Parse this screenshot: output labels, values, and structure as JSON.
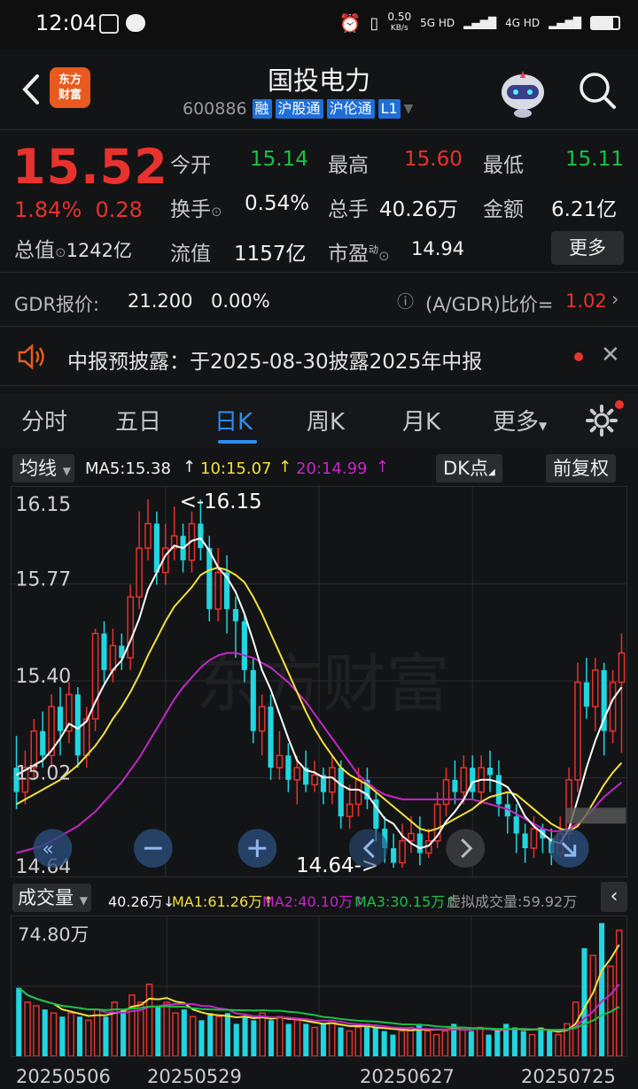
{
  "status": {
    "time": "12:04",
    "net_speed": "0.50",
    "net_unit": "KB/s",
    "sim1": "5G HD",
    "sim2": "4G HD"
  },
  "header": {
    "logo_line1": "东方",
    "logo_line2": "财富",
    "title": "国投电力",
    "code": "600886",
    "tags": [
      "融",
      "沪股通",
      "沪伦通",
      "L1"
    ]
  },
  "quote": {
    "price": "15.52",
    "pct": "1.84%",
    "change": "0.28",
    "mcap_label": "总值",
    "mcap": "1242亿",
    "open_label": "今开",
    "open": "15.14",
    "high_label": "最高",
    "high": "15.60",
    "low_label": "最低",
    "low": "15.11",
    "turnover_label": "换手",
    "turnover": "0.54%",
    "volume_label": "总手",
    "volume": "40.26万",
    "amount_label": "金额",
    "amount": "6.21亿",
    "float_label": "流值",
    "float_mcap": "1157亿",
    "pe_label": "市盈",
    "pe_sup": "动",
    "pe": "14.94",
    "more": "更多"
  },
  "gdr": {
    "label": "GDR报价:",
    "price": "21.200",
    "pct": "0.00%",
    "ratio_label": "(A/GDR)比价=",
    "ratio": "1.02"
  },
  "notice": {
    "text": "中报预披露：于2025-08-30披露2025年中报"
  },
  "tabs": [
    "分时",
    "五日",
    "日K",
    "周K",
    "月K",
    "更多"
  ],
  "ma_bar": {
    "selector": "均线",
    "ma5": "MA5:15.38",
    "ma10": "10:15.07",
    "ma20": "20:14.99",
    "dk": "DK点",
    "adjust": "前复权"
  },
  "kline_axis": [
    "16.15",
    "15.77",
    "15.40",
    "15.02",
    "14.64"
  ],
  "kline_annotations": {
    "high": "<-16.15",
    "low": "14.64->"
  },
  "vol_bar": {
    "selector": "成交量",
    "vol": "40.26万",
    "ma1": "MA1:61.26万",
    "ma2": "MA2:40.10万",
    "ma3": "MA3:30.15万",
    "virtual": "虚拟成交量:59.92万"
  },
  "vol_axis_max": "74.80万",
  "dates": [
    "20250506",
    "20250529",
    "20250627",
    "20250725"
  ],
  "colors": {
    "up": "#e8322d",
    "down": "#21d6e0",
    "ma5": "#ffffff",
    "ma10": "#f3e13a",
    "ma20": "#c327c6",
    "accent": "#2f8cf0"
  },
  "watermark": "东方财富",
  "chart_data": {
    "type": "candlestick",
    "ylim": [
      14.64,
      16.15
    ],
    "candles": [
      [
        15.05,
        14.95,
        15.18,
        14.88
      ],
      [
        14.95,
        15.05,
        15.12,
        14.9
      ],
      [
        15.05,
        15.2,
        15.25,
        15.0
      ],
      [
        15.2,
        15.1,
        15.28,
        15.05
      ],
      [
        15.1,
        15.3,
        15.35,
        15.05
      ],
      [
        15.3,
        15.2,
        15.38,
        15.1
      ],
      [
        15.2,
        15.35,
        15.4,
        15.15
      ],
      [
        15.35,
        15.1,
        15.38,
        15.05
      ],
      [
        15.1,
        15.25,
        15.3,
        15.05
      ],
      [
        15.25,
        15.6,
        15.62,
        15.2
      ],
      [
        15.6,
        15.45,
        15.65,
        15.4
      ],
      [
        15.45,
        15.55,
        15.62,
        15.4
      ],
      [
        15.55,
        15.5,
        15.6,
        15.45
      ],
      [
        15.5,
        15.75,
        15.8,
        15.45
      ],
      [
        15.75,
        15.95,
        16.1,
        15.7
      ],
      [
        15.95,
        16.05,
        16.15,
        15.9
      ],
      [
        16.05,
        15.85,
        16.1,
        15.8
      ],
      [
        15.85,
        15.95,
        16.05,
        15.8
      ],
      [
        15.95,
        16.0,
        16.12,
        15.9
      ],
      [
        16.0,
        15.9,
        16.05,
        15.85
      ],
      [
        15.9,
        16.05,
        16.1,
        15.85
      ],
      [
        16.05,
        15.95,
        16.15,
        15.9
      ],
      [
        15.95,
        15.7,
        16.0,
        15.65
      ],
      [
        15.7,
        15.85,
        15.95,
        15.65
      ],
      [
        15.85,
        15.7,
        15.92,
        15.6
      ],
      [
        15.7,
        15.65,
        15.75,
        15.5
      ],
      [
        15.65,
        15.45,
        15.68,
        15.4
      ],
      [
        15.45,
        15.2,
        15.5,
        15.15
      ],
      [
        15.2,
        15.3,
        15.35,
        15.1
      ],
      [
        15.3,
        15.05,
        15.35,
        15.0
      ],
      [
        15.05,
        15.1,
        15.2,
        15.0
      ],
      [
        15.1,
        15.0,
        15.15,
        14.95
      ],
      [
        15.0,
        15.05,
        15.1,
        14.9
      ],
      [
        15.05,
        14.98,
        15.12,
        14.95
      ],
      [
        14.98,
        15.02,
        15.08,
        14.95
      ],
      [
        15.02,
        14.95,
        15.05,
        14.9
      ],
      [
        14.95,
        15.05,
        15.1,
        14.9
      ],
      [
        15.05,
        14.85,
        15.08,
        14.8
      ],
      [
        14.85,
        14.9,
        14.98,
        14.8
      ],
      [
        14.9,
        15.0,
        15.05,
        14.85
      ],
      [
        15.0,
        14.92,
        15.05,
        14.88
      ],
      [
        14.92,
        14.8,
        14.95,
        14.75
      ],
      [
        14.8,
        14.72,
        14.85,
        14.66
      ],
      [
        14.72,
        14.66,
        14.78,
        14.64
      ],
      [
        14.66,
        14.75,
        14.82,
        14.64
      ],
      [
        14.75,
        14.78,
        14.85,
        14.7
      ],
      [
        14.78,
        14.7,
        14.85,
        14.65
      ],
      [
        14.7,
        14.75,
        14.8,
        14.68
      ],
      [
        14.75,
        14.9,
        14.95,
        14.72
      ],
      [
        14.9,
        15.0,
        15.05,
        14.85
      ],
      [
        15.0,
        14.95,
        15.08,
        14.9
      ],
      [
        14.95,
        15.05,
        15.1,
        14.9
      ],
      [
        15.05,
        14.95,
        15.1,
        14.92
      ],
      [
        14.95,
        15.05,
        15.1,
        14.9
      ],
      [
        15.05,
        15.02,
        15.12,
        14.95
      ],
      [
        15.02,
        14.9,
        15.08,
        14.85
      ],
      [
        14.9,
        14.85,
        14.95,
        14.78
      ],
      [
        14.85,
        14.78,
        14.9,
        14.7
      ],
      [
        14.78,
        14.72,
        14.82,
        14.66
      ],
      [
        14.72,
        14.8,
        14.85,
        14.68
      ],
      [
        14.8,
        14.76,
        14.82,
        14.7
      ],
      [
        14.76,
        14.7,
        14.8,
        14.65
      ],
      [
        14.7,
        14.78,
        14.85,
        14.68
      ],
      [
        14.78,
        15.0,
        15.05,
        14.75
      ],
      [
        15.0,
        15.4,
        15.48,
        14.95
      ],
      [
        15.4,
        15.3,
        15.5,
        15.25
      ],
      [
        15.3,
        15.45,
        15.5,
        15.2
      ],
      [
        15.45,
        15.2,
        15.48,
        15.1
      ],
      [
        15.2,
        15.4,
        15.45,
        15.15
      ],
      [
        15.4,
        15.52,
        15.6,
        15.11
      ]
    ],
    "volumes": [
      38,
      30,
      28,
      26,
      24,
      22,
      24,
      22,
      20,
      26,
      22,
      30,
      26,
      34,
      30,
      40,
      28,
      30,
      24,
      26,
      22,
      20,
      24,
      22,
      24,
      18,
      22,
      20,
      24,
      20,
      22,
      18,
      20,
      18,
      16,
      18,
      20,
      16,
      14,
      16,
      18,
      16,
      14,
      12,
      14,
      16,
      18,
      14,
      12,
      14,
      18,
      16,
      14,
      16,
      12,
      14,
      18,
      16,
      14,
      12,
      16,
      14,
      12,
      18,
      30,
      60,
      56,
      74,
      50,
      70
    ],
    "ma5": [
      15.02,
      15.04,
      15.06,
      15.08,
      15.12,
      15.17,
      15.23,
      15.21,
      15.24,
      15.32,
      15.39,
      15.45,
      15.49,
      15.57,
      15.66,
      15.78,
      15.85,
      15.92,
      15.96,
      15.95,
      15.98,
      15.99,
      15.94,
      15.87,
      15.83,
      15.77,
      15.68,
      15.57,
      15.45,
      15.37,
      15.27,
      15.17,
      15.08,
      15.04,
      15.03,
      15.01,
      15.01,
      14.98,
      14.96,
      14.96,
      14.94,
      14.89,
      14.84,
      14.82,
      14.77,
      14.74,
      14.72,
      14.73,
      14.77,
      14.83,
      14.87,
      14.92,
      14.99,
      15.0,
      15.0,
      14.99,
      14.97,
      14.92,
      14.85,
      14.81,
      14.78,
      14.75,
      14.74,
      14.8,
      14.92,
      15.05,
      15.16,
      15.25,
      15.33,
      15.38
    ],
    "ma10": [
      14.9,
      14.92,
      14.94,
      14.96,
      14.98,
      15.0,
      15.03,
      15.06,
      15.1,
      15.14,
      15.19,
      15.25,
      15.3,
      15.36,
      15.43,
      15.51,
      15.58,
      15.65,
      15.71,
      15.75,
      15.79,
      15.84,
      15.86,
      15.87,
      15.86,
      15.84,
      15.81,
      15.75,
      15.68,
      15.6,
      15.52,
      15.44,
      15.36,
      15.28,
      15.21,
      15.15,
      15.1,
      15.05,
      15.02,
      15.0,
      14.98,
      14.95,
      14.92,
      14.89,
      14.86,
      14.83,
      14.8,
      14.79,
      14.8,
      14.82,
      14.84,
      14.86,
      14.88,
      14.91,
      14.93,
      14.94,
      14.95,
      14.94,
      14.91,
      14.88,
      14.85,
      14.82,
      14.8,
      14.79,
      14.81,
      14.86,
      14.92,
      14.98,
      15.03,
      15.07
    ],
    "ma20": [
      14.7,
      14.71,
      14.72,
      14.73,
      14.75,
      14.77,
      14.79,
      14.81,
      14.84,
      14.87,
      14.91,
      14.95,
      14.99,
      15.04,
      15.09,
      15.15,
      15.21,
      15.27,
      15.33,
      15.38,
      15.42,
      15.46,
      15.49,
      15.51,
      15.52,
      15.52,
      15.51,
      15.5,
      15.48,
      15.46,
      15.43,
      15.4,
      15.36,
      15.32,
      15.27,
      15.22,
      15.17,
      15.12,
      15.07,
      15.02,
      14.99,
      14.96,
      14.94,
      14.93,
      14.92,
      14.92,
      14.92,
      14.92,
      14.92,
      14.92,
      14.92,
      14.92,
      14.92,
      14.91,
      14.9,
      14.89,
      14.88,
      14.86,
      14.84,
      14.82,
      14.8,
      14.79,
      14.79,
      14.8,
      14.82,
      14.85,
      14.89,
      14.93,
      14.96,
      14.99
    ]
  }
}
